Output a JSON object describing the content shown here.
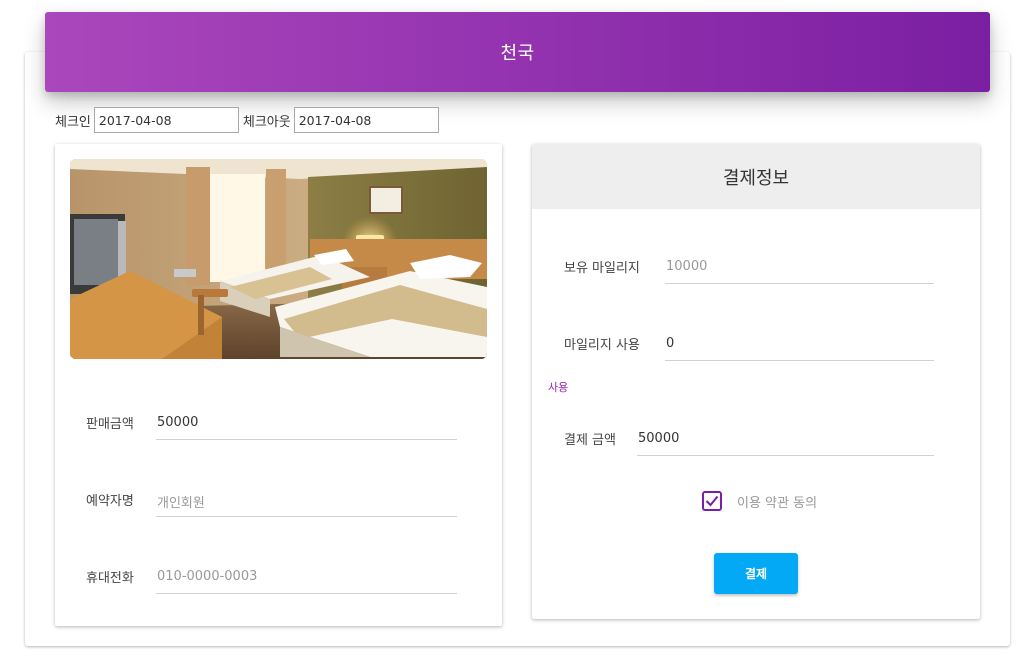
{
  "header": {
    "title": "천국"
  },
  "dates": {
    "checkin_label": "체크인",
    "checkin_value": "2017-04-08",
    "checkout_label": "체크아웃",
    "checkout_value": "2017-04-08"
  },
  "booking": {
    "price_label": "판매금액",
    "price_value": "50000",
    "name_label": "예약자명",
    "name_placeholder": "개인회원",
    "phone_label": "휴대전화",
    "phone_placeholder": "010-0000-0003"
  },
  "payment": {
    "title": "결제정보",
    "owned_mileage_label": "보유 마일리지",
    "owned_mileage_value": "10000",
    "use_mileage_label": "마일리지 사용",
    "use_mileage_value": "0",
    "use_link": "사용",
    "pay_amount_label": "결제 금액",
    "pay_amount_value": "50000",
    "agree_label": "이용 약관 동의",
    "agree_checked": true,
    "pay_button": "결제"
  },
  "colors": {
    "header_gradient_start": "#ab47bc",
    "header_gradient_end": "#7b1fa2",
    "accent_purple": "#9c27b0",
    "pay_button": "#03a9f4"
  },
  "icons": {
    "room_image": "hotel-room-photo",
    "checkbox": "check-icon"
  }
}
